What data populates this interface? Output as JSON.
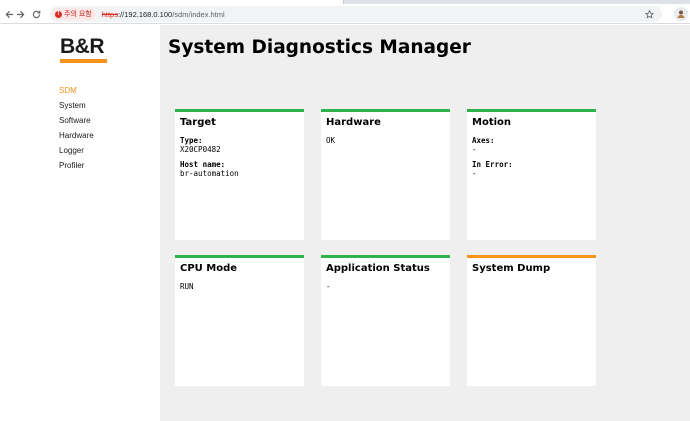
{
  "browser": {
    "back_icon": "arrow-left-icon",
    "forward_icon": "arrow-right-icon",
    "reload_icon": "reload-icon",
    "security_label": "주의 요함",
    "url_scheme": "https",
    "url_host": "://192.168.0.100",
    "url_path": "/sdm/index.html",
    "bookmark_icon": "star-icon",
    "profile_icon": "profile-avatar-icon"
  },
  "logo": {
    "text": "B&R",
    "accent_color": "#f7941d"
  },
  "sidebar": {
    "items": [
      {
        "label": "SDM",
        "active": true
      },
      {
        "label": "System",
        "active": false
      },
      {
        "label": "Software",
        "active": false
      },
      {
        "label": "Hardware",
        "active": false
      },
      {
        "label": "Logger",
        "active": false
      },
      {
        "label": "Profiler",
        "active": false
      }
    ]
  },
  "main": {
    "title": "System Diagnostics Manager",
    "status_colors": {
      "ok": "#2db34a",
      "warning": "#f7941d"
    },
    "cards": [
      {
        "title": "Target",
        "status": "ok",
        "fields": [
          {
            "label": "Type:",
            "value": "X20CP0482"
          },
          {
            "label": "Host name:",
            "value": "br-automation"
          }
        ]
      },
      {
        "title": "Hardware",
        "status": "ok",
        "text": "OK"
      },
      {
        "title": "Motion",
        "status": "ok",
        "fields": [
          {
            "label": "Axes:",
            "value": "-"
          },
          {
            "label": "In Error:",
            "value": "-"
          }
        ]
      },
      {
        "title": "CPU Mode",
        "status": "ok",
        "text": "RUN"
      },
      {
        "title": "Application Status",
        "status": "ok",
        "text": "-"
      },
      {
        "title": "System Dump",
        "status": "warning",
        "text": ""
      }
    ]
  }
}
